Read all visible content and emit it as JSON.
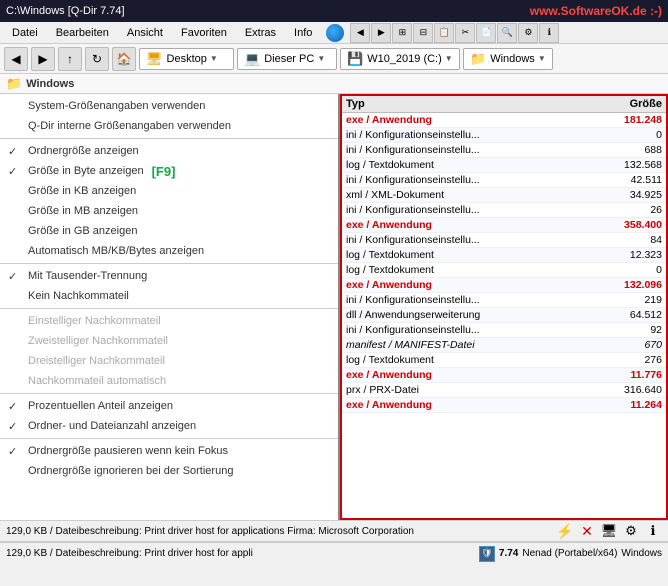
{
  "titleBar": {
    "title": "C:\\Windows  [Q-Dir 7.74]",
    "brand": "www.SoftwareOK.de  :-)"
  },
  "menuBar": {
    "items": [
      "Datei",
      "Bearbeiten",
      "Ansicht",
      "Favoriten",
      "Extras",
      "Info"
    ]
  },
  "toolbar": {
    "desktop": "Desktop",
    "pc": "Dieser PC",
    "drive": "W10_2019 (C:)",
    "folder": "Windows"
  },
  "pathBar": {
    "label": "Windows"
  },
  "leftMenu": {
    "items": [
      {
        "label": "System-Größenangaben verwenden",
        "checked": false,
        "disabled": false
      },
      {
        "label": "Q-Dir interne Größenangaben verwenden",
        "checked": false,
        "disabled": false
      },
      {
        "separator": true
      },
      {
        "label": "Ordnergröße anzeigen",
        "checked": true,
        "disabled": false
      },
      {
        "label": "Größe in Byte anzeigen",
        "checked": true,
        "disabled": false,
        "f9": true
      },
      {
        "label": "Größe in KB anzeigen",
        "checked": false,
        "disabled": false
      },
      {
        "label": "Größe in MB anzeigen",
        "checked": false,
        "disabled": false
      },
      {
        "label": "Größe in GB anzeigen",
        "checked": false,
        "disabled": false
      },
      {
        "label": "Automatisch MB/KB/Bytes anzeigen",
        "checked": false,
        "disabled": false
      },
      {
        "separator": true
      },
      {
        "label": "Mit Tausender-Trennung",
        "checked": true,
        "disabled": false
      },
      {
        "label": "Kein Nachkommateil",
        "checked": false,
        "disabled": false
      },
      {
        "separator": true
      },
      {
        "label": "Einstelliger Nachkommateil",
        "checked": false,
        "disabled": false
      },
      {
        "label": "Zweistelliger Nachkommateil",
        "checked": false,
        "disabled": false
      },
      {
        "label": "Dreistelliger Nachkommateil",
        "checked": false,
        "disabled": false
      },
      {
        "label": "Nachkommateil automatisch",
        "checked": false,
        "disabled": false
      },
      {
        "separator": true
      },
      {
        "label": "Prozentuellen Anteil anzeigen",
        "checked": true,
        "disabled": false
      },
      {
        "label": "Ordner- und Dateianzahl anzeigen",
        "checked": true,
        "disabled": false
      },
      {
        "separator": true
      },
      {
        "label": "Ordnergröße pausieren wenn kein Fokus",
        "checked": true,
        "disabled": false
      },
      {
        "label": "Ordnergröße ignorieren bei der Sortierung",
        "checked": false,
        "disabled": false
      }
    ]
  },
  "fileTable": {
    "columns": [
      "Typ",
      "Größe"
    ],
    "rows": [
      {
        "type": "exe / Anwendung",
        "size": "181.248",
        "isExe": true
      },
      {
        "type": "ini / Konfigurationseinstellu...",
        "size": "0",
        "isExe": false
      },
      {
        "type": "ini / Konfigurationseinstellu...",
        "size": "688",
        "isExe": false
      },
      {
        "type": "log / Textdokument",
        "size": "132.568",
        "isExe": false
      },
      {
        "type": "ini / Konfigurationseinstellu...",
        "size": "42.511",
        "isExe": false
      },
      {
        "type": "xml / XML-Dokument",
        "size": "34.925",
        "isExe": false
      },
      {
        "type": "ini / Konfigurationseinstellu...",
        "size": "26",
        "isExe": false
      },
      {
        "type": "exe / Anwendung",
        "size": "358.400",
        "isExe": true
      },
      {
        "type": "ini / Konfigurationseinstellu...",
        "size": "84",
        "isExe": false
      },
      {
        "type": "log / Textdokument",
        "size": "12.323",
        "isExe": false
      },
      {
        "type": "log / Textdokument",
        "size": "0",
        "isExe": false
      },
      {
        "type": "exe / Anwendung",
        "size": "132.096",
        "isExe": true
      },
      {
        "type": "ini / Konfigurationseinstellu...",
        "size": "219",
        "isExe": false
      },
      {
        "type": "dll / Anwendungserweiterung",
        "size": "64.512",
        "isExe": false
      },
      {
        "type": "ini / Konfigurationseinstellu...",
        "size": "92",
        "isExe": false
      },
      {
        "type": "manifest / MANIFEST-Datei",
        "size": "670",
        "isExe": false,
        "isItalic": true
      },
      {
        "type": "log / Textdokument",
        "size": "276",
        "isExe": false
      },
      {
        "type": "exe / Anwendung",
        "size": "11.776",
        "isExe": true
      },
      {
        "type": "prx / PRX-Datei",
        "size": "316.640",
        "isExe": false
      },
      {
        "type": "exe / Anwendung",
        "size": "11.264",
        "isExe": true
      }
    ]
  },
  "statusTop": {
    "text": "129,0 KB / Dateibeschreibung: Print driver host for applications Firma: Microsoft Corporation"
  },
  "statusBottom": {
    "text": "129,0 KB / Dateibeschreibung: Print driver host for appli",
    "version": "7.74",
    "user": "Nenad (Portabel/x64)",
    "os": "Windows"
  }
}
